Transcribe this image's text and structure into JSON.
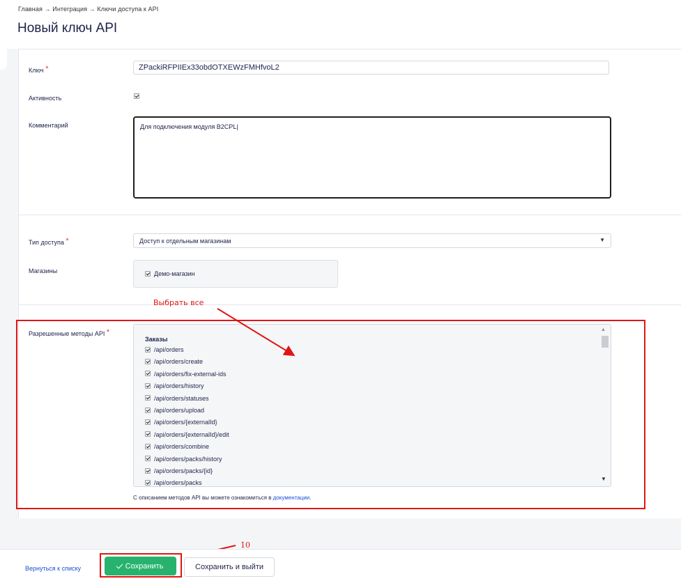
{
  "header": {
    "breadcrumb": "Главная → Интеграция → Ключи доступа к API",
    "title": "Новый ключ API"
  },
  "form": {
    "key_label": "Ключ",
    "key_value": "ZPackiRFPIIEx33obdOTXEWzFMHfvoL2",
    "required_mark": "*",
    "active_label": "Активность",
    "active_checked": true,
    "comment_label": "Комментарий",
    "comment_value": "Для подключения модуля B2CPL|",
    "access_type_label": "Тип доступа",
    "access_type_value": "Доступ к отдельным магазинам",
    "stores_label": "Магазины",
    "stores": [
      "Демо-магазин"
    ],
    "methods_label": "Разрешенные методы API",
    "methods_group": "Заказы",
    "methods": [
      "/api/orders",
      "/api/orders/create",
      "/api/orders/fix-external-ids",
      "/api/orders/history",
      "/api/orders/statuses",
      "/api/orders/upload",
      "/api/orders/{externalId}",
      "/api/orders/{externalId}/edit",
      "/api/orders/combine",
      "/api/orders/packs/history",
      "/api/orders/packs/{id}",
      "/api/orders/packs"
    ],
    "hint_text": "С описанием методов API вы можете ознакомиться в ",
    "hint_link": "документации",
    "hint_end": "."
  },
  "annotations": {
    "select_all": "Выбрать все",
    "step_number": "10",
    "color": "#e01515"
  },
  "footer": {
    "back_link": "Вернуться к списку",
    "save_button": "Сохранить",
    "save_exit_button": "Сохранить и выйти",
    "save_color": "#27b36e"
  }
}
